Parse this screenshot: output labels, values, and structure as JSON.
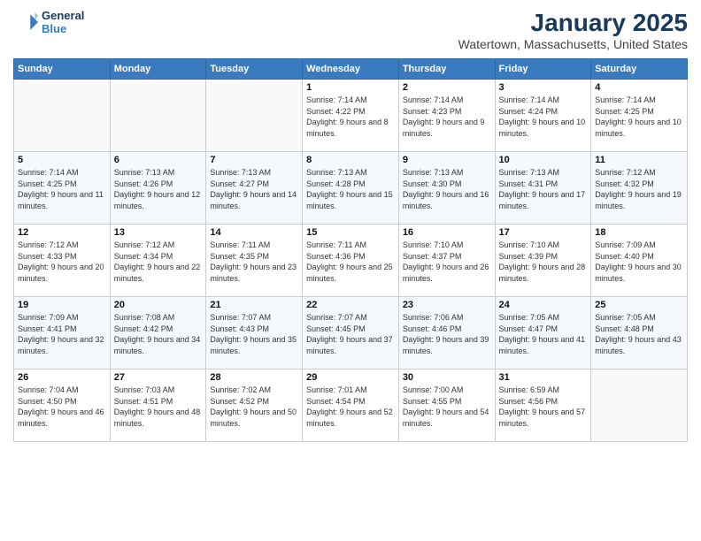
{
  "header": {
    "logo_line1": "General",
    "logo_line2": "Blue",
    "title": "January 2025",
    "subtitle": "Watertown, Massachusetts, United States"
  },
  "days_of_week": [
    "Sunday",
    "Monday",
    "Tuesday",
    "Wednesday",
    "Thursday",
    "Friday",
    "Saturday"
  ],
  "weeks": [
    [
      {
        "day": "",
        "info": ""
      },
      {
        "day": "",
        "info": ""
      },
      {
        "day": "",
        "info": ""
      },
      {
        "day": "1",
        "info": "Sunrise: 7:14 AM\nSunset: 4:22 PM\nDaylight: 9 hours and 8 minutes."
      },
      {
        "day": "2",
        "info": "Sunrise: 7:14 AM\nSunset: 4:23 PM\nDaylight: 9 hours and 9 minutes."
      },
      {
        "day": "3",
        "info": "Sunrise: 7:14 AM\nSunset: 4:24 PM\nDaylight: 9 hours and 10 minutes."
      },
      {
        "day": "4",
        "info": "Sunrise: 7:14 AM\nSunset: 4:25 PM\nDaylight: 9 hours and 10 minutes."
      }
    ],
    [
      {
        "day": "5",
        "info": "Sunrise: 7:14 AM\nSunset: 4:25 PM\nDaylight: 9 hours and 11 minutes."
      },
      {
        "day": "6",
        "info": "Sunrise: 7:13 AM\nSunset: 4:26 PM\nDaylight: 9 hours and 12 minutes."
      },
      {
        "day": "7",
        "info": "Sunrise: 7:13 AM\nSunset: 4:27 PM\nDaylight: 9 hours and 14 minutes."
      },
      {
        "day": "8",
        "info": "Sunrise: 7:13 AM\nSunset: 4:28 PM\nDaylight: 9 hours and 15 minutes."
      },
      {
        "day": "9",
        "info": "Sunrise: 7:13 AM\nSunset: 4:30 PM\nDaylight: 9 hours and 16 minutes."
      },
      {
        "day": "10",
        "info": "Sunrise: 7:13 AM\nSunset: 4:31 PM\nDaylight: 9 hours and 17 minutes."
      },
      {
        "day": "11",
        "info": "Sunrise: 7:12 AM\nSunset: 4:32 PM\nDaylight: 9 hours and 19 minutes."
      }
    ],
    [
      {
        "day": "12",
        "info": "Sunrise: 7:12 AM\nSunset: 4:33 PM\nDaylight: 9 hours and 20 minutes."
      },
      {
        "day": "13",
        "info": "Sunrise: 7:12 AM\nSunset: 4:34 PM\nDaylight: 9 hours and 22 minutes."
      },
      {
        "day": "14",
        "info": "Sunrise: 7:11 AM\nSunset: 4:35 PM\nDaylight: 9 hours and 23 minutes."
      },
      {
        "day": "15",
        "info": "Sunrise: 7:11 AM\nSunset: 4:36 PM\nDaylight: 9 hours and 25 minutes."
      },
      {
        "day": "16",
        "info": "Sunrise: 7:10 AM\nSunset: 4:37 PM\nDaylight: 9 hours and 26 minutes."
      },
      {
        "day": "17",
        "info": "Sunrise: 7:10 AM\nSunset: 4:39 PM\nDaylight: 9 hours and 28 minutes."
      },
      {
        "day": "18",
        "info": "Sunrise: 7:09 AM\nSunset: 4:40 PM\nDaylight: 9 hours and 30 minutes."
      }
    ],
    [
      {
        "day": "19",
        "info": "Sunrise: 7:09 AM\nSunset: 4:41 PM\nDaylight: 9 hours and 32 minutes."
      },
      {
        "day": "20",
        "info": "Sunrise: 7:08 AM\nSunset: 4:42 PM\nDaylight: 9 hours and 34 minutes."
      },
      {
        "day": "21",
        "info": "Sunrise: 7:07 AM\nSunset: 4:43 PM\nDaylight: 9 hours and 35 minutes."
      },
      {
        "day": "22",
        "info": "Sunrise: 7:07 AM\nSunset: 4:45 PM\nDaylight: 9 hours and 37 minutes."
      },
      {
        "day": "23",
        "info": "Sunrise: 7:06 AM\nSunset: 4:46 PM\nDaylight: 9 hours and 39 minutes."
      },
      {
        "day": "24",
        "info": "Sunrise: 7:05 AM\nSunset: 4:47 PM\nDaylight: 9 hours and 41 minutes."
      },
      {
        "day": "25",
        "info": "Sunrise: 7:05 AM\nSunset: 4:48 PM\nDaylight: 9 hours and 43 minutes."
      }
    ],
    [
      {
        "day": "26",
        "info": "Sunrise: 7:04 AM\nSunset: 4:50 PM\nDaylight: 9 hours and 46 minutes."
      },
      {
        "day": "27",
        "info": "Sunrise: 7:03 AM\nSunset: 4:51 PM\nDaylight: 9 hours and 48 minutes."
      },
      {
        "day": "28",
        "info": "Sunrise: 7:02 AM\nSunset: 4:52 PM\nDaylight: 9 hours and 50 minutes."
      },
      {
        "day": "29",
        "info": "Sunrise: 7:01 AM\nSunset: 4:54 PM\nDaylight: 9 hours and 52 minutes."
      },
      {
        "day": "30",
        "info": "Sunrise: 7:00 AM\nSunset: 4:55 PM\nDaylight: 9 hours and 54 minutes."
      },
      {
        "day": "31",
        "info": "Sunrise: 6:59 AM\nSunset: 4:56 PM\nDaylight: 9 hours and 57 minutes."
      },
      {
        "day": "",
        "info": ""
      }
    ]
  ]
}
